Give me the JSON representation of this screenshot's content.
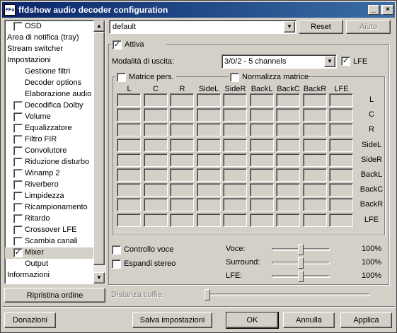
{
  "window": {
    "title": "ffdshow audio decoder configuration",
    "icon_text": "FFa",
    "minimize": "_",
    "maximize": "□",
    "close": "×"
  },
  "tree": {
    "items": [
      {
        "label": "OSD",
        "checkbox": true,
        "checked": false,
        "indent": 1
      },
      {
        "label": "Area di notifica (tray)",
        "checkbox": false,
        "indent": 0
      },
      {
        "label": "Stream switcher",
        "checkbox": false,
        "indent": 0
      },
      {
        "label": "Impostazioni",
        "checkbox": false,
        "indent": 0
      },
      {
        "label": "Gestione filtri",
        "checkbox": false,
        "indent": 2
      },
      {
        "label": "Decoder options",
        "checkbox": false,
        "indent": 2
      },
      {
        "label": "Elaborazione audio",
        "checkbox": false,
        "indent": 2
      },
      {
        "label": "Decodifica Dolby",
        "checkbox": true,
        "checked": false,
        "indent": 1
      },
      {
        "label": "Volume",
        "checkbox": true,
        "checked": false,
        "indent": 1
      },
      {
        "label": "Equalizzatore",
        "checkbox": true,
        "checked": false,
        "indent": 1
      },
      {
        "label": "Filtro FIR",
        "checkbox": true,
        "checked": false,
        "indent": 1
      },
      {
        "label": "Convolutore",
        "checkbox": true,
        "checked": false,
        "indent": 1
      },
      {
        "label": "Riduzione disturbo",
        "checkbox": true,
        "checked": false,
        "indent": 1
      },
      {
        "label": "Winamp 2",
        "checkbox": true,
        "checked": false,
        "indent": 1
      },
      {
        "label": "Riverbero",
        "checkbox": true,
        "checked": false,
        "indent": 1
      },
      {
        "label": "Limpidezza",
        "checkbox": true,
        "checked": false,
        "indent": 1
      },
      {
        "label": "Ricampionamento",
        "checkbox": true,
        "checked": false,
        "indent": 1
      },
      {
        "label": "Ritardo",
        "checkbox": true,
        "checked": false,
        "indent": 1
      },
      {
        "label": "Crossover LFE",
        "checkbox": true,
        "checked": false,
        "indent": 1
      },
      {
        "label": "Scambia canali",
        "checkbox": true,
        "checked": false,
        "indent": 1
      },
      {
        "label": "Mixer",
        "checkbox": true,
        "checked": true,
        "indent": 1,
        "selected": true
      },
      {
        "label": "Output",
        "checkbox": false,
        "indent": 2
      },
      {
        "label": "Informazioni",
        "checkbox": false,
        "indent": 0
      }
    ]
  },
  "preset": {
    "value": "default",
    "reset_label": "Reset",
    "aiuto_label": "Aiuto"
  },
  "mixer": {
    "attiva_label": "Attiva",
    "attiva_checked": true,
    "output_mode_label": "Modalità di uscita:",
    "output_mode_value": "3/0/2 - 5 channels",
    "lfe_label": "LFE",
    "lfe_checked": true,
    "custom_matrix_label": "Matrice pers.",
    "normalize_label": "Normalizza matrice",
    "matrix_columns": [
      "L",
      "C",
      "R",
      "SideL",
      "SideR",
      "BackL",
      "BackC",
      "BackR",
      "LFE"
    ],
    "matrix_rows": [
      "L",
      "C",
      "R",
      "SideL",
      "SideR",
      "BackL",
      "BackC",
      "BackR",
      "LFE"
    ],
    "voice_control_label": "Controllo voce",
    "expand_stereo_label": "Espandi stereo",
    "sliders": [
      {
        "label": "Voce:",
        "value": "100%",
        "level": 0.5
      },
      {
        "label": "Surround:",
        "value": "100%",
        "level": 0.5
      },
      {
        "label": "LFE:",
        "value": "100%",
        "level": 0.5
      }
    ],
    "headphone_label": "Distanza cuffie:"
  },
  "buttons": {
    "ripristina": "Ripristina ordine",
    "donazioni": "Donazioni",
    "salva": "Salva impostazioni",
    "ok": "OK",
    "annulla": "Annulla",
    "applica": "Applica"
  }
}
